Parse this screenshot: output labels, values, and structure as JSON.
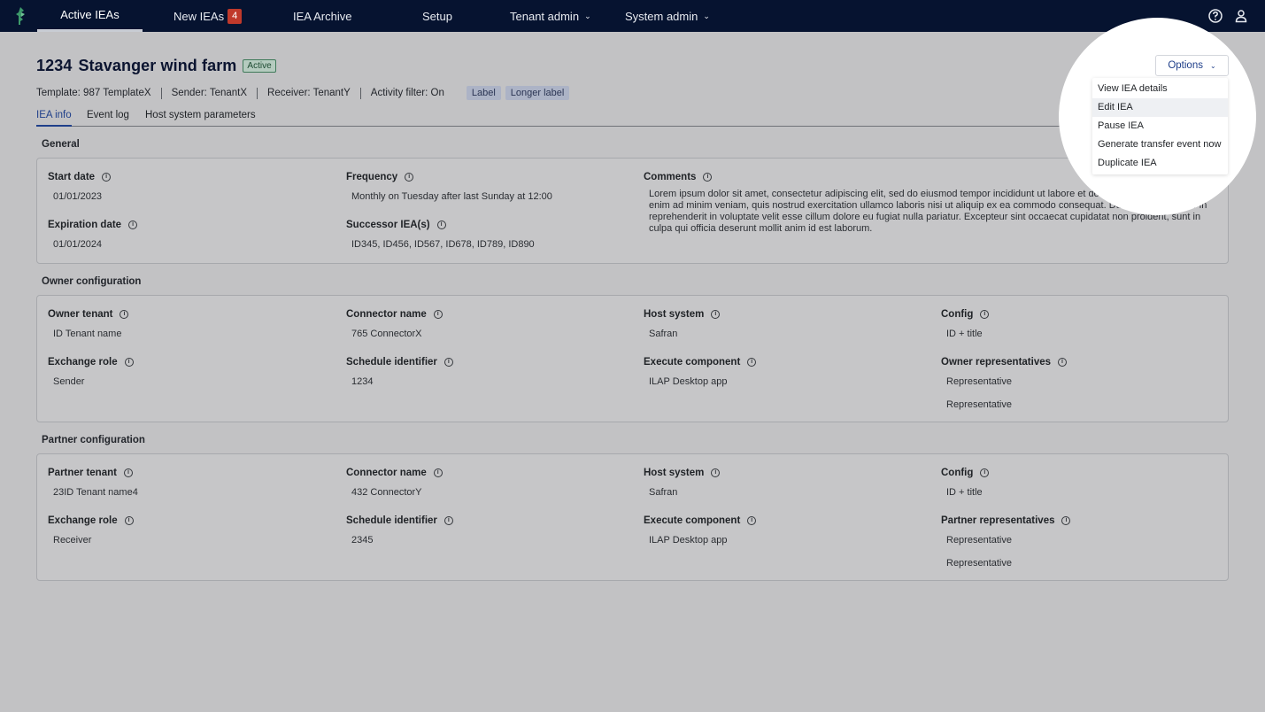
{
  "nav": {
    "items": [
      {
        "label": "Active IEAs"
      },
      {
        "label": "New IEAs",
        "count": "4"
      },
      {
        "label": "IEA Archive"
      },
      {
        "label": "Setup"
      },
      {
        "label": "Tenant admin"
      },
      {
        "label": "System admin"
      }
    ]
  },
  "header": {
    "id": "1234",
    "name": "Stavanger wind farm",
    "status": "Active",
    "meta": [
      "Template: 987 TemplateX",
      "Sender: TenantX",
      "Receiver: TenantY",
      "Activity filter: On"
    ],
    "labels": [
      "Label",
      "Longer label"
    ]
  },
  "tabs": [
    "IEA info",
    "Event log",
    "Host system parameters"
  ],
  "options": {
    "button_label": "Options",
    "menu": [
      "View IEA details",
      "Edit IEA",
      "Pause IEA",
      "Generate transfer event now",
      "Duplicate IEA"
    ]
  },
  "general": {
    "title": "General",
    "start_date": {
      "label": "Start date",
      "value": "01/01/2023"
    },
    "expiration_date": {
      "label": "Expiration date",
      "value": "01/01/2024"
    },
    "frequency": {
      "label": "Frequency",
      "value": "Monthly on Tuesday after last Sunday at 12:00"
    },
    "successor": {
      "label": "Successor IEA(s)",
      "value": "ID345, ID456, ID567, ID678, ID789, ID890"
    },
    "comments": {
      "label": "Comments",
      "value": "Lorem ipsum dolor sit amet, consectetur adipiscing elit, sed do eiusmod tempor incididunt ut labore et dolore magna aliqua. Ut enim ad minim veniam, quis nostrud exercitation ullamco laboris nisi ut aliquip ex ea commodo consequat. Duis aute irure dolor in reprehenderit in voluptate velit esse cillum dolore eu fugiat nulla pariatur. Excepteur sint occaecat cupidatat non proident, sunt in culpa qui officia deserunt mollit anim id est laborum."
    }
  },
  "owner": {
    "title": "Owner configuration",
    "tenant": {
      "label": "Owner tenant",
      "value": "ID Tenant name"
    },
    "exchange_role": {
      "label": "Exchange role",
      "value": "Sender"
    },
    "connector": {
      "label": "Connector name",
      "value": "765 ConnectorX"
    },
    "schedule": {
      "label": "Schedule identifier",
      "value": "1234"
    },
    "host": {
      "label": "Host system",
      "value": "Safran"
    },
    "execute": {
      "label": "Execute component",
      "value": "ILAP Desktop app"
    },
    "config": {
      "label": "Config",
      "value": "ID + title"
    },
    "reps": {
      "label": "Owner representatives",
      "values": [
        "Representative",
        "Representative"
      ]
    }
  },
  "partner": {
    "title": "Partner configuration",
    "tenant": {
      "label": "Partner tenant",
      "value": "23ID Tenant name4"
    },
    "exchange_role": {
      "label": "Exchange role",
      "value": "Receiver"
    },
    "connector": {
      "label": "Connector name",
      "value": "432 ConnectorY"
    },
    "schedule": {
      "label": "Schedule identifier",
      "value": "2345"
    },
    "host": {
      "label": "Host system",
      "value": "Safran"
    },
    "execute": {
      "label": "Execute component",
      "value": "ILAP Desktop app"
    },
    "config": {
      "label": "Config",
      "value": "ID + title"
    },
    "reps": {
      "label": "Partner representatives",
      "values": [
        "Representative",
        "Representative"
      ]
    }
  },
  "colors": {
    "nav_bg": "#061330",
    "accent": "#1f3f8a",
    "status_green": "#3f7a5a",
    "badge_red": "#c0392b"
  }
}
